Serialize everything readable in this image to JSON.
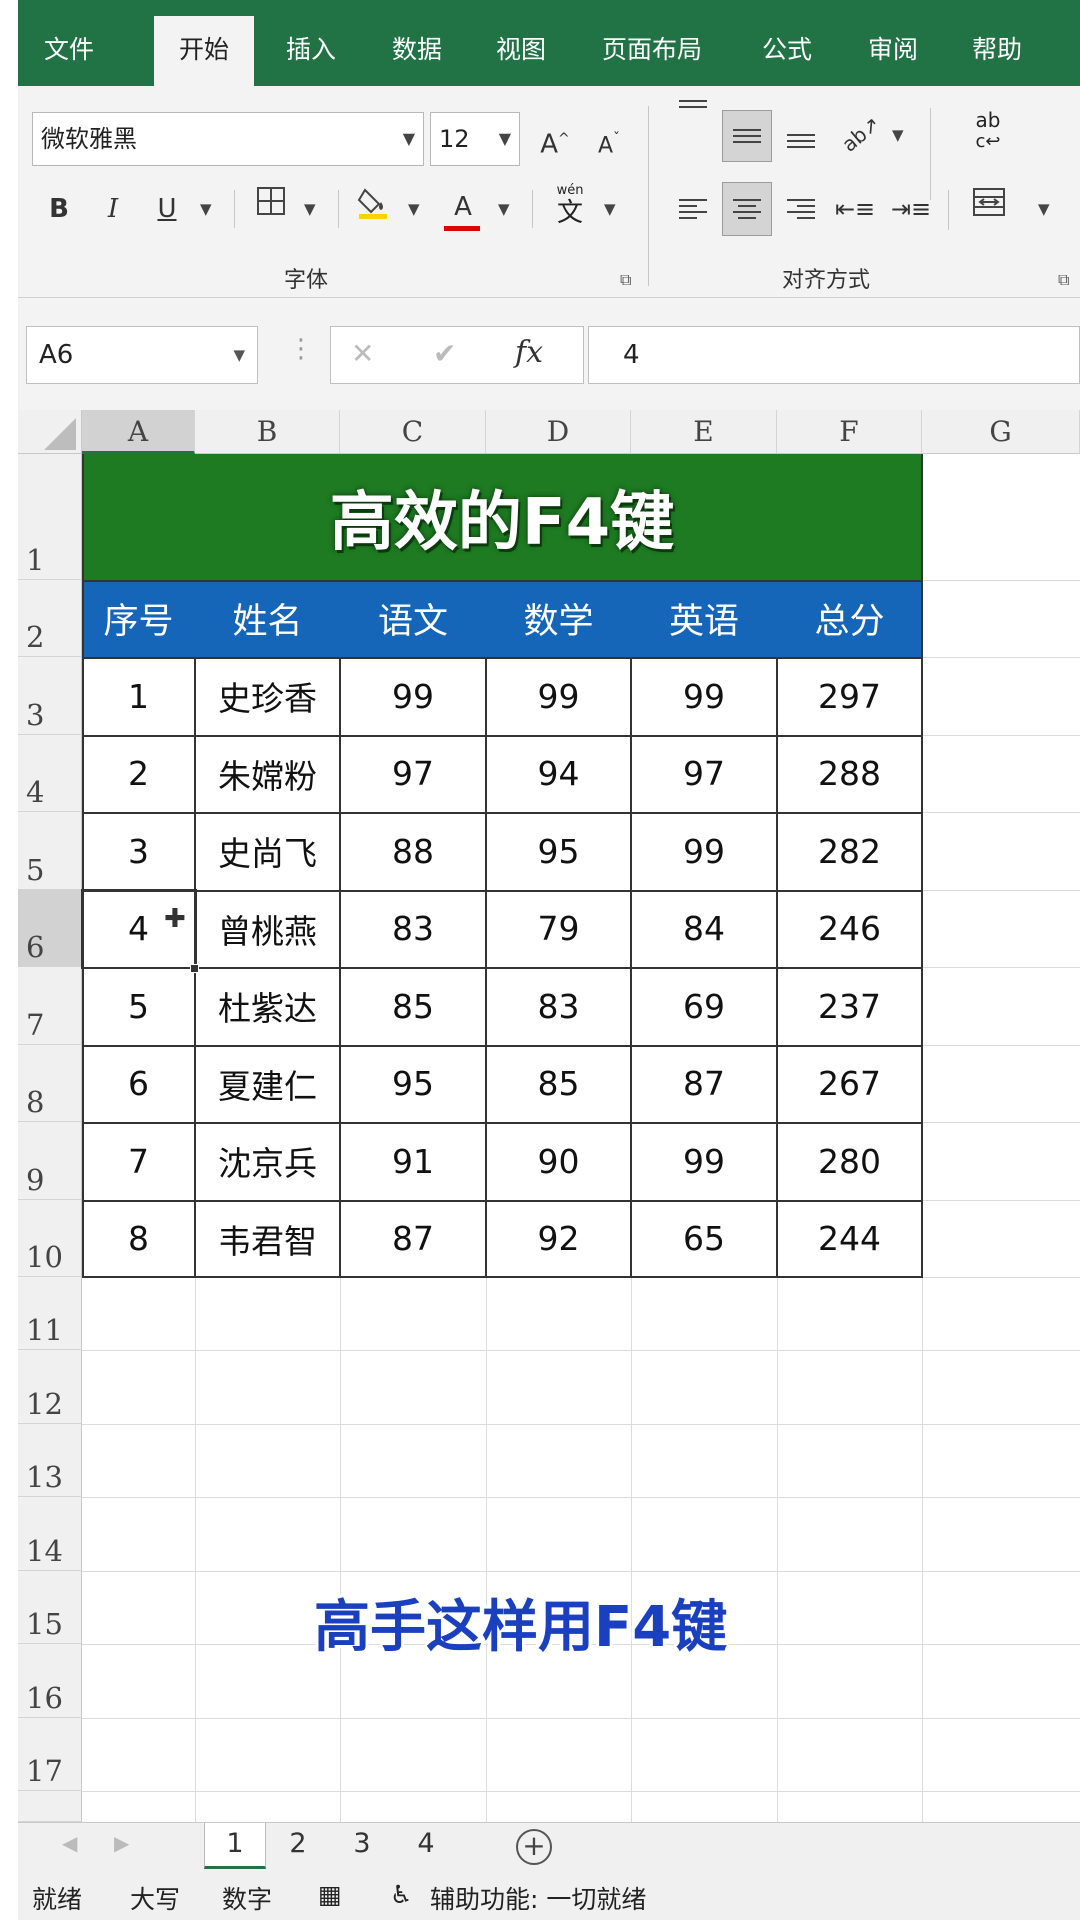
{
  "ribbon_tabs": [
    "文件",
    "开始",
    "插入",
    "数据",
    "视图",
    "页面布局",
    "公式",
    "审阅",
    "帮助"
  ],
  "font": {
    "family": "微软雅黑",
    "size": "12",
    "bold": "B",
    "italic": "I",
    "underline": "U",
    "font_color": "A",
    "grow": "A",
    "shrink": "A",
    "phonetic": "文",
    "phonetic_top": "wén",
    "group_label": "字体"
  },
  "alignment": {
    "group_label": "对齐方式",
    "wrap_text": "ab"
  },
  "formula_bar": {
    "name_box": "A6",
    "cancel": "✕",
    "enter": "✔",
    "fx": "fx",
    "value": "4"
  },
  "columns": [
    "A",
    "B",
    "C",
    "D",
    "E",
    "F",
    "G"
  ],
  "rows": [
    "1",
    "2",
    "3",
    "4",
    "5",
    "6",
    "7",
    "8",
    "9",
    "10",
    "11",
    "12",
    "13",
    "14",
    "15",
    "16",
    "17"
  ],
  "table": {
    "title": "高效的F4键",
    "headers": [
      "序号",
      "姓名",
      "语文",
      "数学",
      "英语",
      "总分"
    ],
    "rows": [
      [
        "1",
        "史珍香",
        "99",
        "99",
        "99",
        "297"
      ],
      [
        "2",
        "朱嫦粉",
        "97",
        "94",
        "97",
        "288"
      ],
      [
        "3",
        "史尚飞",
        "88",
        "95",
        "99",
        "282"
      ],
      [
        "4",
        "曾桃燕",
        "83",
        "79",
        "84",
        "246"
      ],
      [
        "5",
        "杜紫达",
        "85",
        "83",
        "69",
        "237"
      ],
      [
        "6",
        "夏建仁",
        "95",
        "85",
        "87",
        "267"
      ],
      [
        "7",
        "沈京兵",
        "91",
        "90",
        "99",
        "280"
      ],
      [
        "8",
        "韦君智",
        "87",
        "92",
        "65",
        "244"
      ]
    ]
  },
  "overlay_caption": "高手这样用F4键",
  "sheet_tabs": [
    "1",
    "2",
    "3",
    "4"
  ],
  "add_sheet": "+",
  "status": {
    "ready": "就绪",
    "caps": "大写",
    "num": "数字",
    "accessibility": "辅助功能: 一切就绪"
  },
  "colors": {
    "excel_green": "#217346",
    "title_green": "#1e7b22",
    "header_blue": "#1565b8",
    "caption_blue": "#1a3fbf"
  }
}
